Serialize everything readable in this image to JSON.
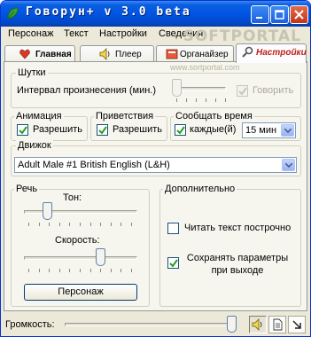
{
  "window": {
    "title": "Говорун+ v 3.0 beta",
    "icons": {
      "app": "leaf-icon",
      "minimize": "minimize-icon",
      "maximize": "maximize-icon",
      "close": "close-icon"
    }
  },
  "menu": [
    "Персонаж",
    "Текст",
    "Настройки",
    "Сведения"
  ],
  "watermark": "SOFTPORTAL",
  "tabs": [
    {
      "label": "Главная",
      "icon": "heart-icon",
      "active": false
    },
    {
      "label": "Плеер",
      "icon": "speaker-icon",
      "active": false
    },
    {
      "label": "Органайзер",
      "icon": "organizer-icon",
      "active": false
    },
    {
      "label": "Настройки",
      "icon": "settings-icon",
      "active": true
    }
  ],
  "watermark_url": "www.sortportal.com",
  "jokes": {
    "legend": "Шутки",
    "interval_label": "Интервал произнесения (мин.)",
    "speak_label": "Говорить",
    "speak_checked": true,
    "speak_enabled": false,
    "interval_level": 0
  },
  "animation": {
    "legend": "Анимация",
    "allow_label": "Разрешить",
    "checked": true
  },
  "greetings": {
    "legend": "Приветствия",
    "allow_label": "Разрешить",
    "checked": true
  },
  "time": {
    "legend": "Сообщать время",
    "every_label": "каждые(й)",
    "checked": true,
    "interval": "15 мин"
  },
  "engine": {
    "legend": "Движок",
    "selected": "Adult Male #1 British English (L&H)"
  },
  "speech": {
    "legend": "Речь",
    "tone_label": "Тон:",
    "tone_level": 0.18,
    "speed_label": "Скорость:",
    "speed_level": 0.69,
    "character_button": "Персонаж"
  },
  "extra": {
    "legend": "Дополнительно",
    "read_lines_label": "Читать текст построчно",
    "read_lines_checked": false,
    "save_params_label": "Сохранять параметры при выходе",
    "save_params_checked": true
  },
  "status": {
    "volume_label": "Громкость:",
    "volume_level": 1.0,
    "buttons": [
      "speaker-icon",
      "document-icon",
      "resize-arrow-icon"
    ]
  }
}
